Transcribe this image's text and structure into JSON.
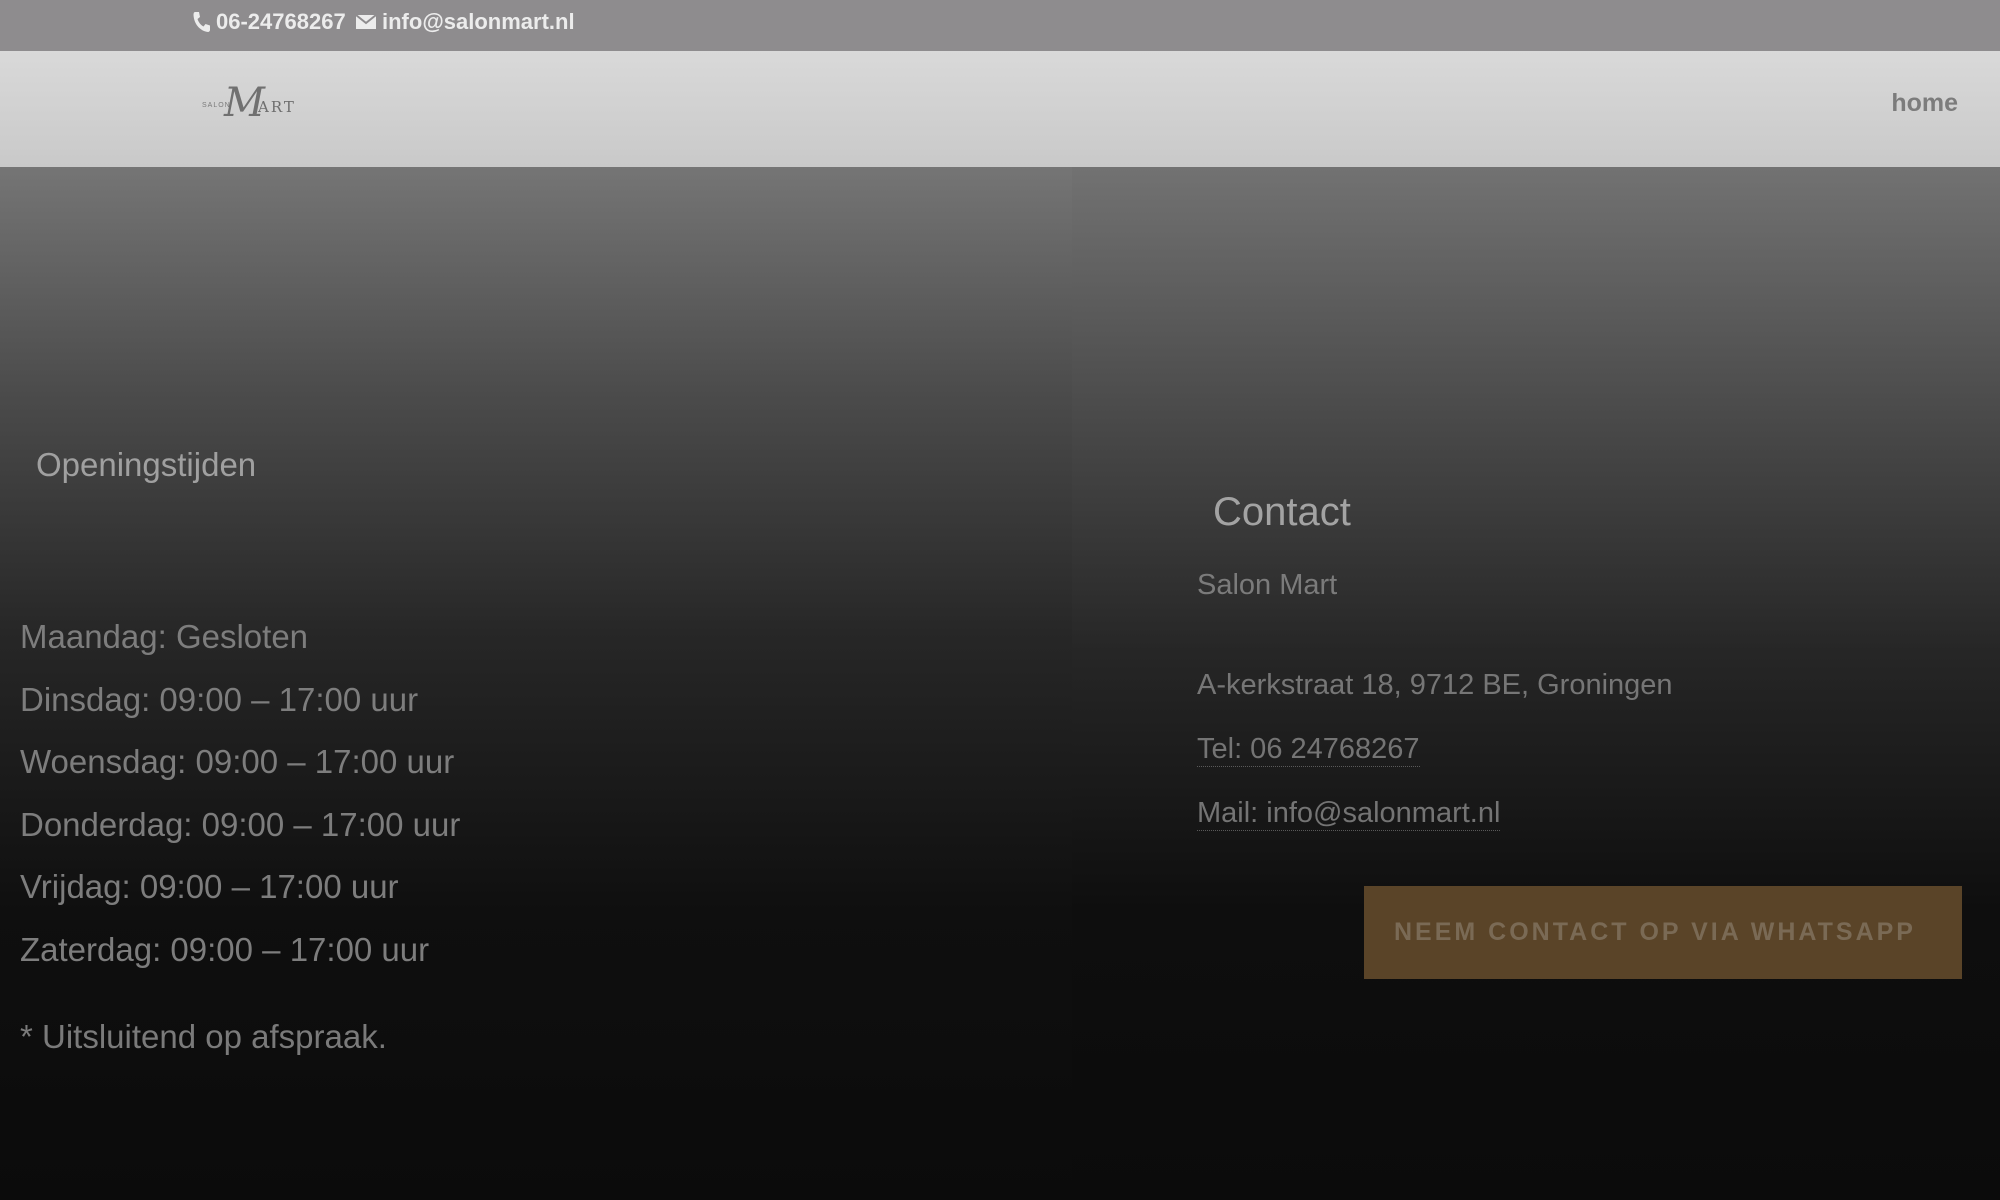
{
  "topbar": {
    "phone": "06-24768267",
    "email": "info@salonmart.nl",
    "phone_icon": "phone-icon",
    "email_icon": "envelope-icon"
  },
  "header": {
    "logo": {
      "small": "SALON",
      "script": "M",
      "rest": "ART"
    },
    "nav": {
      "home": "home"
    }
  },
  "hours_section": {
    "title": "Openingstijden",
    "days": [
      "Maandag: Gesloten",
      "Dinsdag: 09:00 – 17:00 uur",
      "Woensdag: 09:00 – 17:00 uur",
      "Donderdag: 09:00 – 17:00 uur",
      "Vrijdag: 09:00 – 17:00 uur",
      "Zaterdag: 09:00 – 17:00 uur"
    ],
    "note": "* Uitsluitend op afspraak."
  },
  "contact_section": {
    "title": "Contact",
    "name": "Salon Mart",
    "address": "A-kerkstraat 18, 9712 BE, Groningen",
    "tel": "Tel: 06 24768267",
    "mail": "Mail: info@salonmart.nl",
    "whatsapp_button": "NEEM CONTACT OP VIA WHATSAPP"
  },
  "colors": {
    "topbar_bg": "#8e8c8e",
    "header_bg": "#d0d0d0",
    "button_bg": "#5a4428"
  }
}
